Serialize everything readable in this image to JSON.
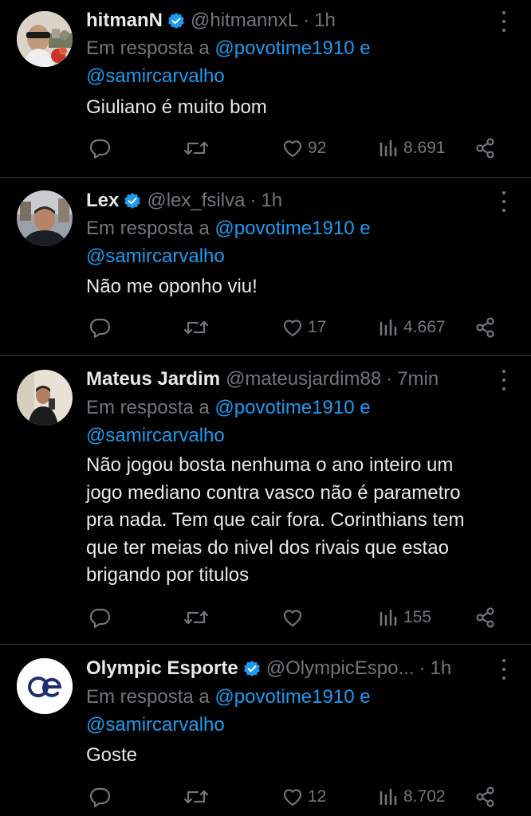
{
  "labels": {
    "reply_prefix": "Em resposta a",
    "conjunction": "e"
  },
  "tweets": [
    {
      "name": "hitmanN",
      "verified": true,
      "handle": "@hitmannxL",
      "time": "1h",
      "mentions": [
        "@povotime1910",
        "@samircarvalho"
      ],
      "text": [
        "Giuliano é muito bom"
      ],
      "likes": "92",
      "views": "8.691",
      "avatar_icon": "user-photo"
    },
    {
      "name": "Lex",
      "verified": true,
      "handle": "@lex_fsilva",
      "time": "1h",
      "mentions": [
        "@povotime1910",
        "@samircarvalho"
      ],
      "text": [
        "Não me oponho viu!"
      ],
      "likes": "17",
      "views": "4.667",
      "avatar_icon": "user-photo"
    },
    {
      "name": "Mateus Jardim",
      "verified": false,
      "handle": "@mateusjardim88",
      "time": "7min",
      "mentions": [
        "@povotime1910",
        "@samircarvalho"
      ],
      "text": [
        "Não jogou bosta nenhuma o ano inteiro um",
        "jogo mediano contra vasco não é parametro",
        "pra nada. Tem que cair fora. Corinthians tem",
        "que ter meias do nivel dos rivais que estao",
        "brigando por titulos"
      ],
      "likes": "",
      "views": "155",
      "avatar_icon": "user-photo"
    },
    {
      "name": "Olympic Esporte",
      "verified": true,
      "handle": "@OlympicEspo...",
      "time": "1h",
      "mentions": [
        "@povotime1910",
        "@samircarvalho"
      ],
      "text": [
        "Goste"
      ],
      "likes": "12",
      "views": "8.702",
      "avatar_icon": "oe-logo"
    }
  ],
  "colors": {
    "background": "#000000",
    "text": "#e7e9ea",
    "muted": "#71767b",
    "link": "#1d9bf0",
    "verified": "#1d9bf0",
    "divider": "#2f3336"
  }
}
